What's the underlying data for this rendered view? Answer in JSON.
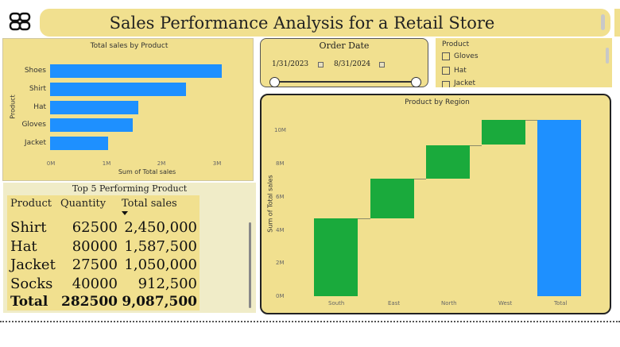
{
  "header": {
    "title": "Sales Performance Analysis for a Retail Store",
    "logo_icon": "logo-icon"
  },
  "bar_chart": {
    "title": "Total sales by Product",
    "xlabel": "Sum of Total sales",
    "ylabel": "Product",
    "ticks": [
      "0M",
      "1M",
      "2M",
      "3M"
    ]
  },
  "order_date": {
    "title": "Order Date",
    "start": "1/31/2023",
    "end": "8/31/2024"
  },
  "product_slicer": {
    "title": "Product",
    "items": [
      "Gloves",
      "Hat",
      "Jacket"
    ]
  },
  "region_chart": {
    "title": "Product by Region",
    "ylabel": "Sum of Total sales",
    "yticks": [
      "0M",
      "2M",
      "4M",
      "6M",
      "8M",
      "10M"
    ],
    "categories": [
      "South",
      "East",
      "North",
      "West",
      "Total"
    ]
  },
  "top5": {
    "title": "Top 5 Performing Product",
    "headers": [
      "Product",
      "Quantity",
      "Total sales"
    ],
    "rows": [
      [
        "Shirt",
        "62500",
        "2,450,000"
      ],
      [
        "Hat",
        "80000",
        "1,587,500"
      ],
      [
        "Jacket",
        "27500",
        "1,050,000"
      ],
      [
        "Socks",
        "40000",
        "912,500"
      ]
    ],
    "total": [
      "Total",
      "282500",
      "9,087,500"
    ]
  },
  "colors": {
    "panel": "#f1e08f",
    "bar": "#1e90ff",
    "increase": "#1aaa3c",
    "total": "#1e90ff"
  },
  "chart_data": [
    {
      "type": "bar",
      "title": "Total sales by Product",
      "categories": [
        "Shoes",
        "Shirt",
        "Hat",
        "Gloves",
        "Jacket"
      ],
      "values": [
        3100000,
        2450000,
        1590000,
        1500000,
        1050000
      ],
      "xlabel": "Sum of Total sales",
      "ylabel": "Product",
      "xlim": [
        0,
        3000000
      ],
      "orientation": "horizontal"
    },
    {
      "type": "bar",
      "subtype": "waterfall",
      "title": "Product by Region",
      "categories": [
        "South",
        "East",
        "North",
        "West",
        "Total"
      ],
      "values": [
        4700000,
        2400000,
        2000000,
        1500000,
        10600000
      ],
      "ylabel": "Sum of Total sales",
      "ylim": [
        0,
        11000000
      ]
    }
  ]
}
